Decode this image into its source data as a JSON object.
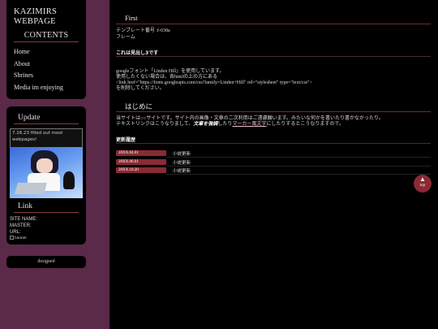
{
  "sidebar": {
    "site_title_line1": "KAZIMIRS",
    "site_title_line2": "WEBPAGE",
    "contents_heading": "CONTENTS",
    "nav": [
      "Home",
      "About",
      "Shrines",
      "Media im enjoying"
    ],
    "update_heading": "Update",
    "update_text": "7.16.23 filled out most webpages!",
    "link_heading": "Link",
    "site_name_label": "SITE NAME:",
    "master_label": "MASTER:",
    "url_label": "URL:",
    "banner_alt": "banner",
    "credit": "designed"
  },
  "main": {
    "first_heading": "First",
    "template_line1": "テンプレート番号 :f-038a",
    "template_line2": "フレーム",
    "midashi_heading": "これは見出し3です",
    "font_line1": "googleフォント「Linden Hill」を使用しています。",
    "font_line2": "使用したくない場合は、各htmlの上の方にある",
    "font_line3": "<link href=\"https://fonts.googleapis.com/css?family=Linden+Hill\" rel=\"stylesheet\" type=\"text/css\">",
    "font_line4": "を削除してください。",
    "intro_heading": "はじめに",
    "intro_line1": "当サイトは○○サイトです。サイト内の画像・文章の二次利用はご遠慮願います。みたいな何かを書いたり書かなかったり。",
    "intro_pre": "テキストリンクはこうなりまして、",
    "intro_bold": "文章を強調",
    "intro_mid": "したり",
    "intro_marker": "マーカー風文字",
    "intro_post": "にしたりするとこうなりますので。",
    "history_heading": "更新履歴",
    "history": [
      {
        "date": "20XX.04.01",
        "text": "小説更新"
      },
      {
        "date": "20XX.06.01",
        "text": "小説更新"
      },
      {
        "date": "20XX.10.20",
        "text": "小説更新"
      }
    ],
    "top_arrow": "▲",
    "top_label": "top"
  }
}
